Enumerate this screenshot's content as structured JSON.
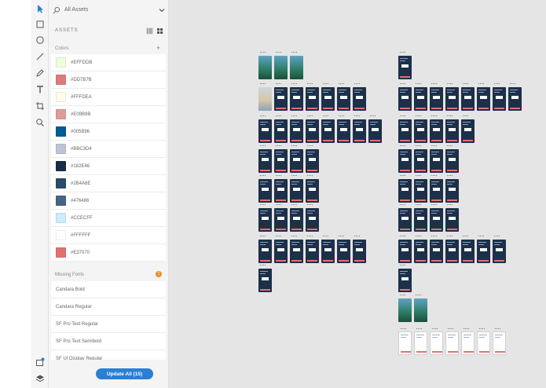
{
  "search": {
    "label": "All Assets"
  },
  "assets": {
    "title": "ASSETS"
  },
  "colors": {
    "label": "Colors",
    "add": "+",
    "items": [
      {
        "hex": "#EFFDDB",
        "swatch": "#EFFDDB"
      },
      {
        "hex": "#DD7B7B",
        "swatch": "#DD7B7B"
      },
      {
        "hex": "#FFFDEA",
        "swatch": "#FFFDEA"
      },
      {
        "hex": "#E09B9B",
        "swatch": "#E09B9B"
      },
      {
        "hex": "#005B96",
        "swatch": "#005B96"
      },
      {
        "hex": "#BBC3D4",
        "swatch": "#BBC3D4"
      },
      {
        "hex": "#182E46",
        "swatch": "#182E46"
      },
      {
        "hex": "#2B4A6E",
        "swatch": "#2B4A6E"
      },
      {
        "hex": "#476486",
        "swatch": "#476486"
      },
      {
        "hex": "#CCECFF",
        "swatch": "#CCECFF"
      },
      {
        "hex": "#FFFFFF",
        "swatch": "#FFFFFF"
      },
      {
        "hex": "#E37070",
        "swatch": "#E37070"
      }
    ]
  },
  "fonts": {
    "label": "Missing Fonts",
    "warning": "!",
    "items": [
      "Candara Bold",
      "Candara Regular",
      "SF Pro Text Regular",
      "SF Pro Text Semibold",
      "SF UI Display Regular"
    ]
  },
  "update_button": "Update All (15)",
  "theme": {
    "accent": "#2a7fd4",
    "artboard": "#1c3049",
    "cta": "#e37070",
    "warning": "#e8902d"
  }
}
